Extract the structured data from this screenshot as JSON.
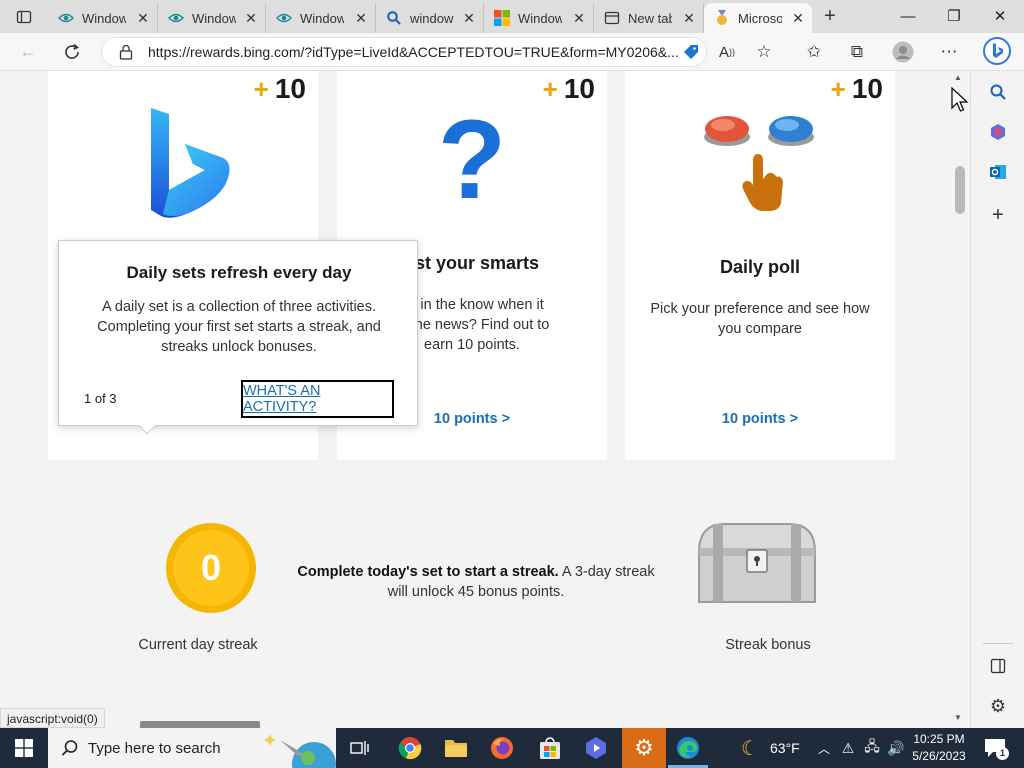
{
  "browser": {
    "tabs": [
      {
        "title": "Windows",
        "icon": "eye-icon"
      },
      {
        "title": "Windows",
        "icon": "eye-icon"
      },
      {
        "title": "Windows",
        "icon": "eye-icon"
      },
      {
        "title": "windows",
        "icon": "search-icon"
      },
      {
        "title": "Windows",
        "icon": "microsoft-logo-icon"
      },
      {
        "title": "New tab",
        "icon": "newtab-icon"
      },
      {
        "title": "Microso",
        "icon": "rewards-medal-icon"
      }
    ],
    "url": "https://rewards.bing.com/?idType=LiveId&ACCEPTEDTOU=TRUE&form=MY0206&..."
  },
  "cards": [
    {
      "points": "10",
      "title": "",
      "desc": "",
      "link": ""
    },
    {
      "points": "10",
      "title": "est your smarts",
      "desc": "ou in the know when it\nto the news? Find out to\nearn 10 points.",
      "link": "10 points >"
    },
    {
      "points": "10",
      "title": "Daily poll",
      "desc": "Pick your preference and see how\nyou compare",
      "link": "10 points >"
    }
  ],
  "popup": {
    "title": "Daily sets refresh every day",
    "body": "A daily set is a collection of three activities. Completing your first set starts a streak, and streaks unlock bonuses.",
    "counter": "1 of 3",
    "action": "WHAT'S AN ACTIVITY?"
  },
  "streak": {
    "count": "0",
    "text_bold": "Complete today's set to start a streak.",
    "text_rest": " A 3-day streak will unlock 45 bonus points.",
    "current_label": "Current day streak",
    "bonus_label": "Streak bonus"
  },
  "status_bar": "javascript:void(0)",
  "taskbar": {
    "search_placeholder": "Type here to search",
    "weather": "63°F",
    "time": "10:25 PM",
    "date": "5/26/2023",
    "notifications": "1"
  },
  "colors": {
    "accent": "#1a6fb3",
    "coin": "#ffc41a",
    "plus": "#e8a600"
  }
}
